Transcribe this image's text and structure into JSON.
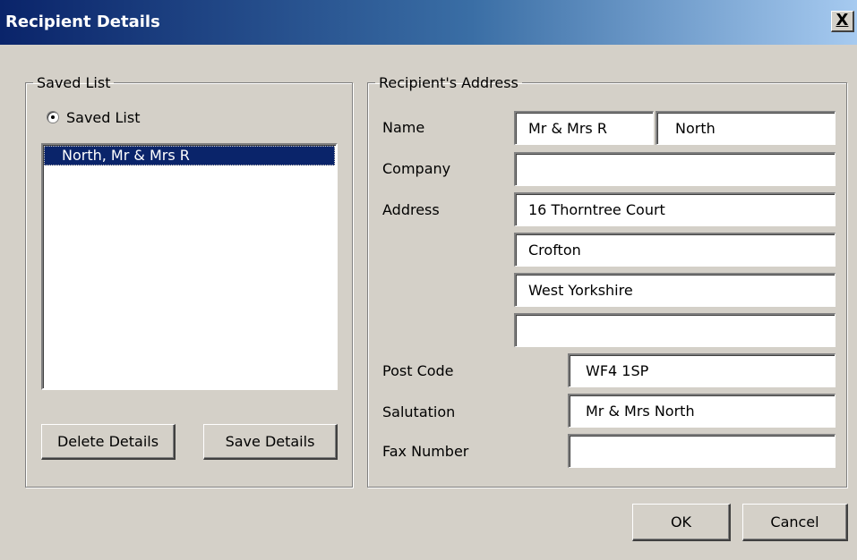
{
  "window": {
    "title": "Recipient Details",
    "close_label": "X"
  },
  "saved_list": {
    "group_label": "Saved List",
    "radio_label": "Saved List",
    "radio_selected": true,
    "items": [
      "North, Mr & Mrs R"
    ],
    "selected_index": 0,
    "delete_button": "Delete Details",
    "save_button": "Save Details"
  },
  "address": {
    "group_label": "Recipient's Address",
    "labels": {
      "name": "Name",
      "company": "Company",
      "address": "Address",
      "post_code": "Post Code",
      "salutation": "Salutation",
      "fax_number": "Fax Number"
    },
    "values": {
      "name_first": "Mr & Mrs R",
      "name_last": "North",
      "company": "",
      "address_line1": "16 Thorntree Court",
      "address_line2": "Crofton",
      "address_line3": "West Yorkshire",
      "address_line4": "",
      "post_code": "WF4 1SP",
      "salutation": "Mr & Mrs North",
      "fax_number": ""
    }
  },
  "footer": {
    "ok_button": "OK",
    "cancel_button": "Cancel"
  },
  "colors": {
    "titlebar_start": "#0a246a",
    "titlebar_end": "#a6caf0",
    "dialog_bg": "#d4d0c8",
    "selection": "#0a246a"
  }
}
